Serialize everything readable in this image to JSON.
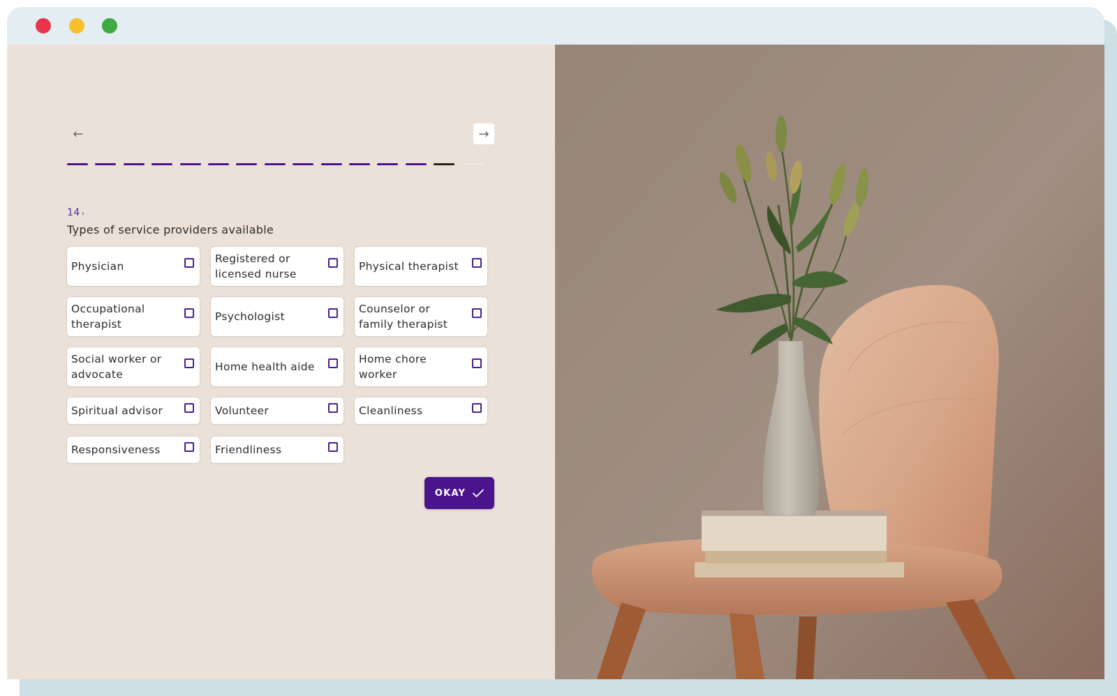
{
  "window": {
    "controls": [
      {
        "name": "close",
        "color": "#e8344c"
      },
      {
        "name": "minimize",
        "color": "#f8c12c"
      },
      {
        "name": "maximize",
        "color": "#3eaa3f"
      }
    ]
  },
  "form": {
    "nav": {
      "back_icon": "arrow-left-icon",
      "next_icon": "arrow-right-icon",
      "back_glyph": "←",
      "next_glyph": "→"
    },
    "progress": {
      "total_steps": 15,
      "completed_steps": 13,
      "current_step": 14,
      "done_color": "#4a148c",
      "current_color": "#2a2418",
      "pending_color": "#efe8e2"
    },
    "question": {
      "number": "14",
      "arrow": "›",
      "title": "Types of service providers available"
    },
    "options": [
      {
        "label": "Physician",
        "checked": false
      },
      {
        "label": "Registered or licensed nurse",
        "checked": false
      },
      {
        "label": "Physical therapist",
        "checked": false
      },
      {
        "label": "Occupational therapist",
        "checked": false
      },
      {
        "label": "Psychologist",
        "checked": false
      },
      {
        "label": "Counselor or family therapist",
        "checked": false
      },
      {
        "label": "Social worker or advocate",
        "checked": false
      },
      {
        "label": "Home health aide",
        "checked": false
      },
      {
        "label": "Home chore worker",
        "checked": false
      },
      {
        "label": "Spiritual advisor",
        "checked": false
      },
      {
        "label": "Volunteer",
        "checked": false
      },
      {
        "label": "Cleanliness",
        "checked": false
      },
      {
        "label": "Responsiveness",
        "checked": false
      },
      {
        "label": "Friendliness",
        "checked": false
      }
    ],
    "submit": {
      "label": "OKAY",
      "icon": "check-icon",
      "color": "#4a148c"
    }
  },
  "photo": {
    "subject": "vase-with-lilies-on-wooden-chair"
  }
}
